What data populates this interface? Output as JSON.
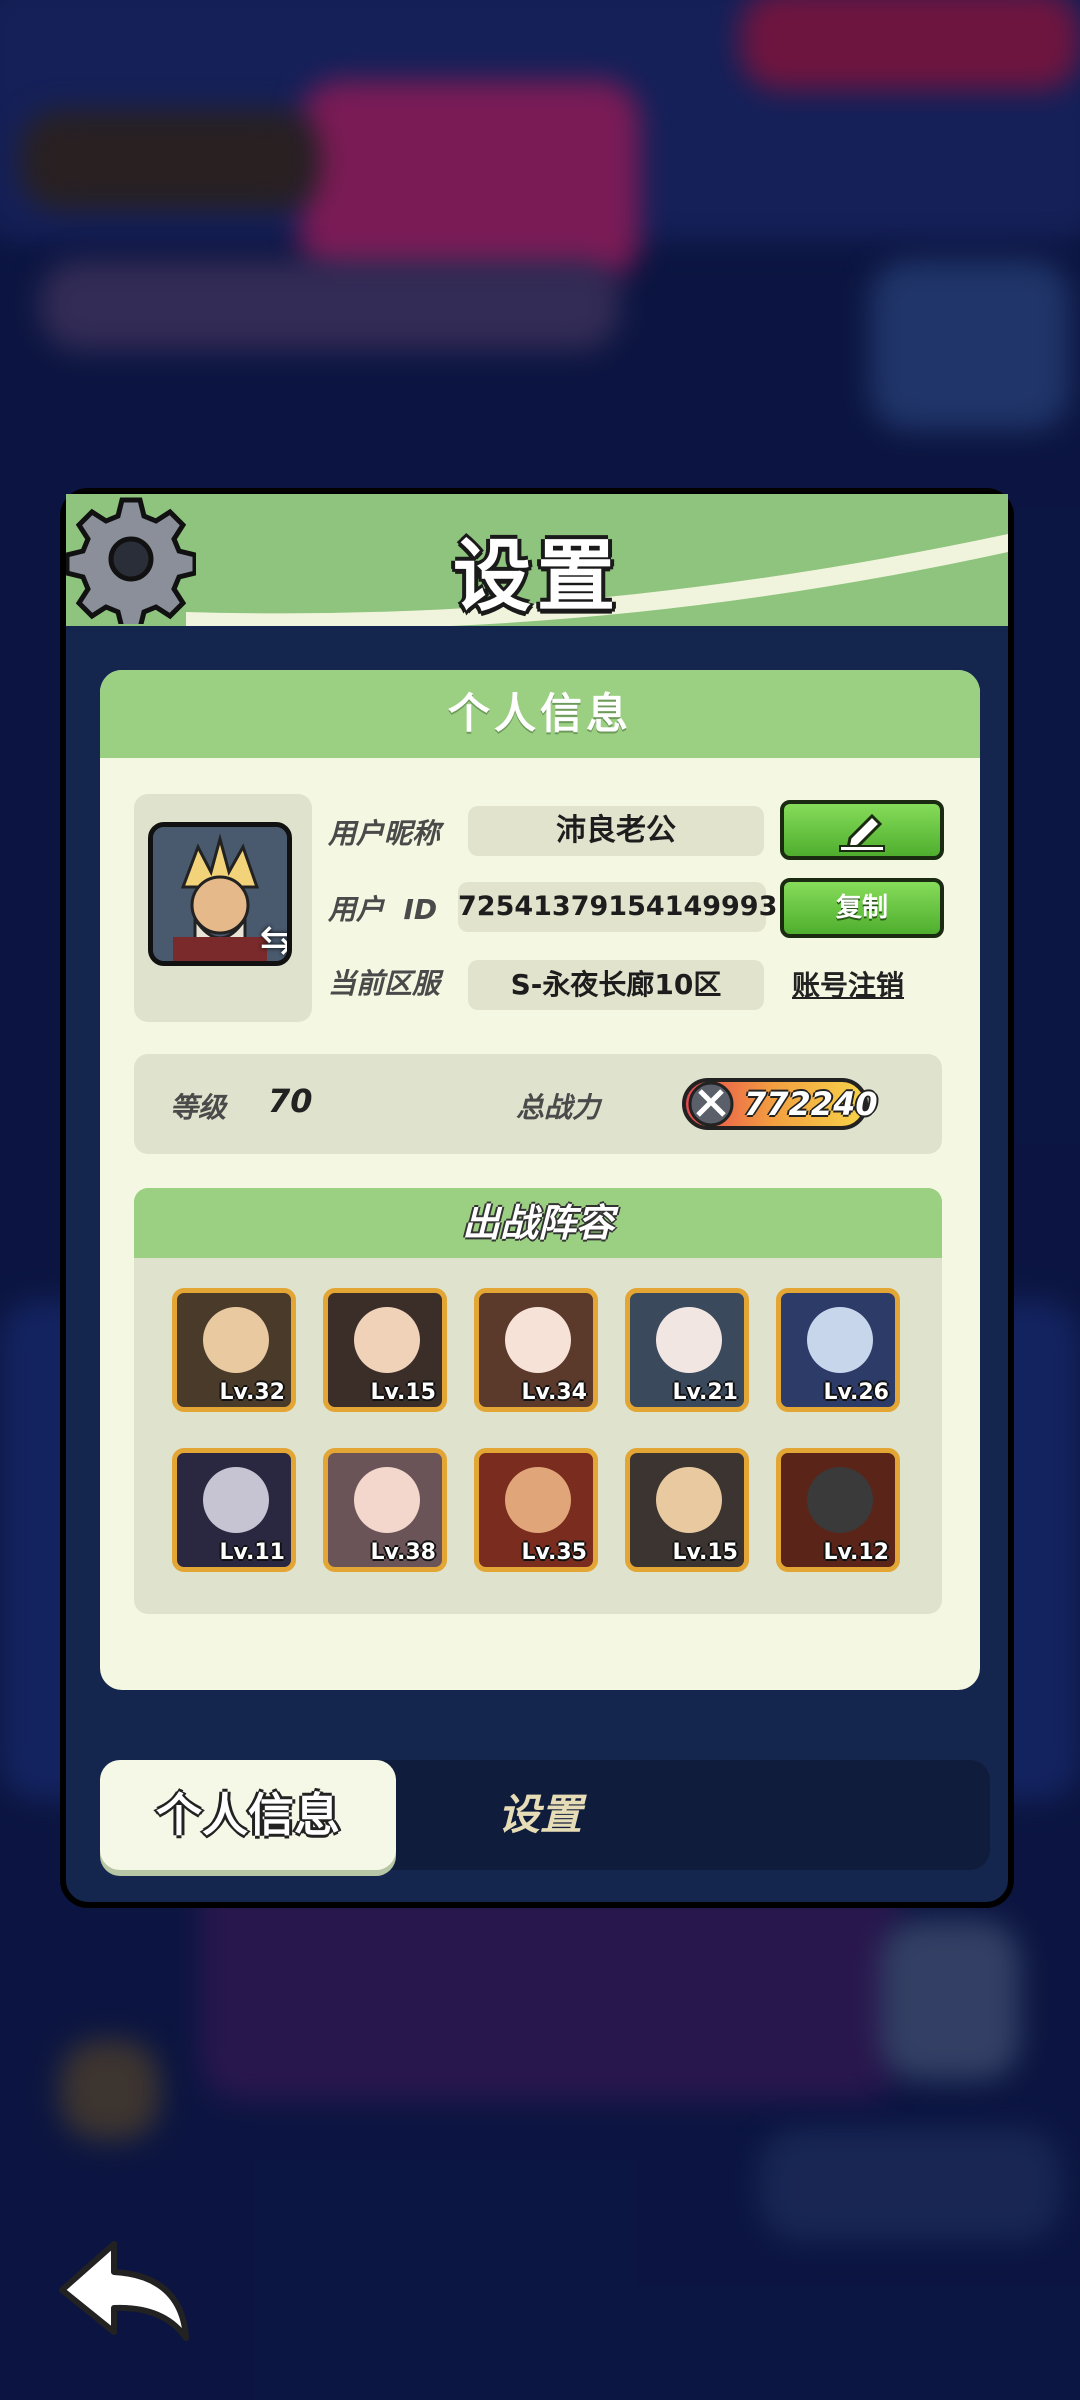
{
  "modal": {
    "title": "设置"
  },
  "profile": {
    "section_title": "个人信息",
    "nickname_label": "用户昵称",
    "nickname": "沛良老公",
    "uid_label": "用户  ID",
    "uid": "72541379154149993",
    "server_label": "当前区服",
    "server": "S-永夜长廊10区",
    "copy_button": "复制",
    "cancel_link": "账号注销",
    "level_label": "等级",
    "level": "70",
    "power_label": "总战力",
    "power": "772240"
  },
  "team": {
    "title": "出战阵容",
    "heroes": [
      {
        "lv": "Lv.32",
        "bg": "#4a3a2a",
        "face": "#e8c9a0"
      },
      {
        "lv": "Lv.15",
        "bg": "#3b2d28",
        "face": "#f0d2b8"
      },
      {
        "lv": "Lv.34",
        "bg": "#5b3a2c",
        "face": "#f6e2d6"
      },
      {
        "lv": "Lv.21",
        "bg": "#3a4a5c",
        "face": "#f2e6e2"
      },
      {
        "lv": "Lv.26",
        "bg": "#2c3b68",
        "face": "#c8d6ec"
      },
      {
        "lv": "Lv.11",
        "bg": "#2a2840",
        "face": "#c6c4d2"
      },
      {
        "lv": "Lv.38",
        "bg": "#6a5458",
        "face": "#f3d6cc"
      },
      {
        "lv": "Lv.35",
        "bg": "#7a2c1e",
        "face": "#e0a67a"
      },
      {
        "lv": "Lv.15",
        "bg": "#3c3430",
        "face": "#e8c9a0"
      },
      {
        "lv": "Lv.12",
        "bg": "#5a2418",
        "face": "#3a3a3a"
      }
    ]
  },
  "tabs": {
    "active": "个人信息",
    "other": "设置"
  },
  "colors": {
    "header_green": "#8fc47e",
    "panel_bg": "#f4f7e1",
    "button_green": "#5cc23a",
    "hero_border": "#e3a533"
  }
}
